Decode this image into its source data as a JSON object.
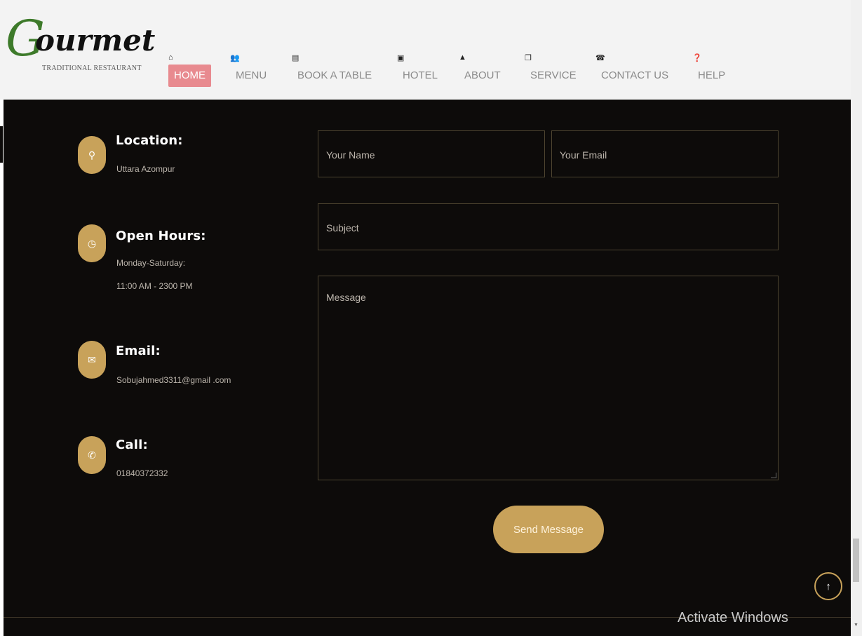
{
  "brand": {
    "name_initial": "G",
    "name_rest": "ourmet",
    "tagline": "TRADITIONAL RESTAURANT"
  },
  "nav": [
    {
      "label": "HOME",
      "icon": "home-icon",
      "glyph": "⌂",
      "active": true
    },
    {
      "label": "MENU",
      "icon": "users-icon",
      "glyph": "👥",
      "active": false
    },
    {
      "label": "BOOK A TABLE",
      "icon": "list-icon",
      "glyph": "▤",
      "active": false
    },
    {
      "label": "HOTEL",
      "icon": "hotel-icon",
      "glyph": "▣",
      "active": false
    },
    {
      "label": "ABOUT",
      "icon": "user-icon",
      "glyph": "▲",
      "active": false
    },
    {
      "label": "SERVICE",
      "icon": "copy-icon",
      "glyph": "❐",
      "active": false
    },
    {
      "label": "CONTACT US",
      "icon": "phone-icon",
      "glyph": "☎",
      "active": false
    },
    {
      "label": "HELP",
      "icon": "question-icon",
      "glyph": "❓",
      "active": false
    }
  ],
  "contact_info": {
    "location": {
      "title": "Location:",
      "lines": [
        "Uttara Azompur"
      ],
      "icon": "location-pin-icon",
      "glyph": "⚲"
    },
    "hours": {
      "title": "Open Hours:",
      "lines": [
        "Monday-Saturday:",
        "11:00 AM - 2300 PM"
      ],
      "icon": "clock-icon",
      "glyph": "◷"
    },
    "email": {
      "title": "Email:",
      "lines": [
        "Sobujahmed3311@gmail .com"
      ],
      "icon": "envelope-icon",
      "glyph": "✉"
    },
    "call": {
      "title": "Call:",
      "lines": [
        "01840372332"
      ],
      "icon": "phone-icon",
      "glyph": "✆"
    }
  },
  "form": {
    "name_placeholder": "Your Name",
    "email_placeholder": "Your Email",
    "subject_placeholder": "Subject",
    "message_placeholder": "Message",
    "submit_label": "Send Message"
  },
  "scroll_top_glyph": "↑",
  "watermark": "Activate Windows",
  "colors": {
    "accent": "#c8a25a",
    "section_bg": "#0d0b0a",
    "nav_active_bg": "#e88a8f",
    "logo_green": "#3d7a2a"
  }
}
